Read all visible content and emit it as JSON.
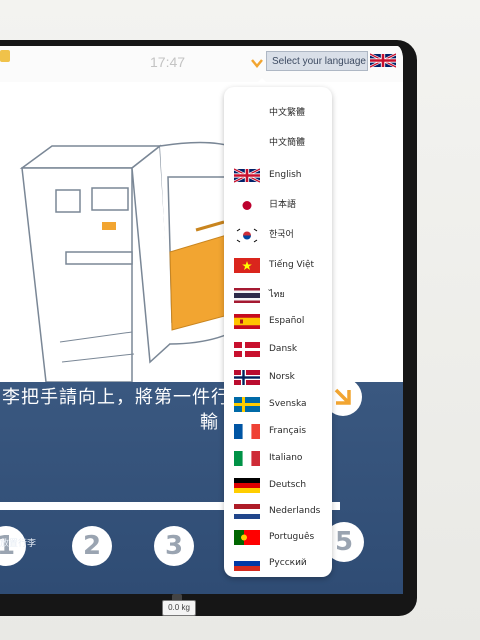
{
  "header": {
    "time": "17:47",
    "language_select_label": "Select your language",
    "current_flag": "uk-flag-icon"
  },
  "instruction": {
    "line1": "李把手請向上，將第一件行",
    "line2": "輸"
  },
  "steps": [
    "1",
    "2",
    "3",
    "5"
  ],
  "step1_label": "放置行李",
  "scale": {
    "weight": "0.0 kg"
  },
  "languages": [
    {
      "label": "中文繁體",
      "flag": "none"
    },
    {
      "label": "中文簡體",
      "flag": "none"
    },
    {
      "label": "English",
      "flag": "uk-flag-icon"
    },
    {
      "label": "日本語",
      "flag": "japan-flag-icon"
    },
    {
      "label": "한국어",
      "flag": "korea-flag-icon"
    },
    {
      "label": "Tiếng Việt",
      "flag": "vietnam-flag-icon"
    },
    {
      "label": "ไทย",
      "flag": "thailand-flag-icon"
    },
    {
      "label": "Español",
      "flag": "spain-flag-icon"
    },
    {
      "label": "Dansk",
      "flag": "denmark-flag-icon"
    },
    {
      "label": "Norsk",
      "flag": "norway-flag-icon"
    },
    {
      "label": "Svenska",
      "flag": "sweden-flag-icon"
    },
    {
      "label": "Français",
      "flag": "france-flag-icon"
    },
    {
      "label": "Italiano",
      "flag": "italy-flag-icon"
    },
    {
      "label": "Deutsch",
      "flag": "germany-flag-icon"
    },
    {
      "label": "Nederlands",
      "flag": "netherlands-flag-icon"
    },
    {
      "label": "Português",
      "flag": "portugal-flag-icon"
    },
    {
      "label": "Русский",
      "flag": "russia-flag-icon"
    }
  ],
  "colors": {
    "panel_blue": "#2f4c74",
    "accent_orange": "#f2a531",
    "select_bg": "#d9dfe8"
  }
}
